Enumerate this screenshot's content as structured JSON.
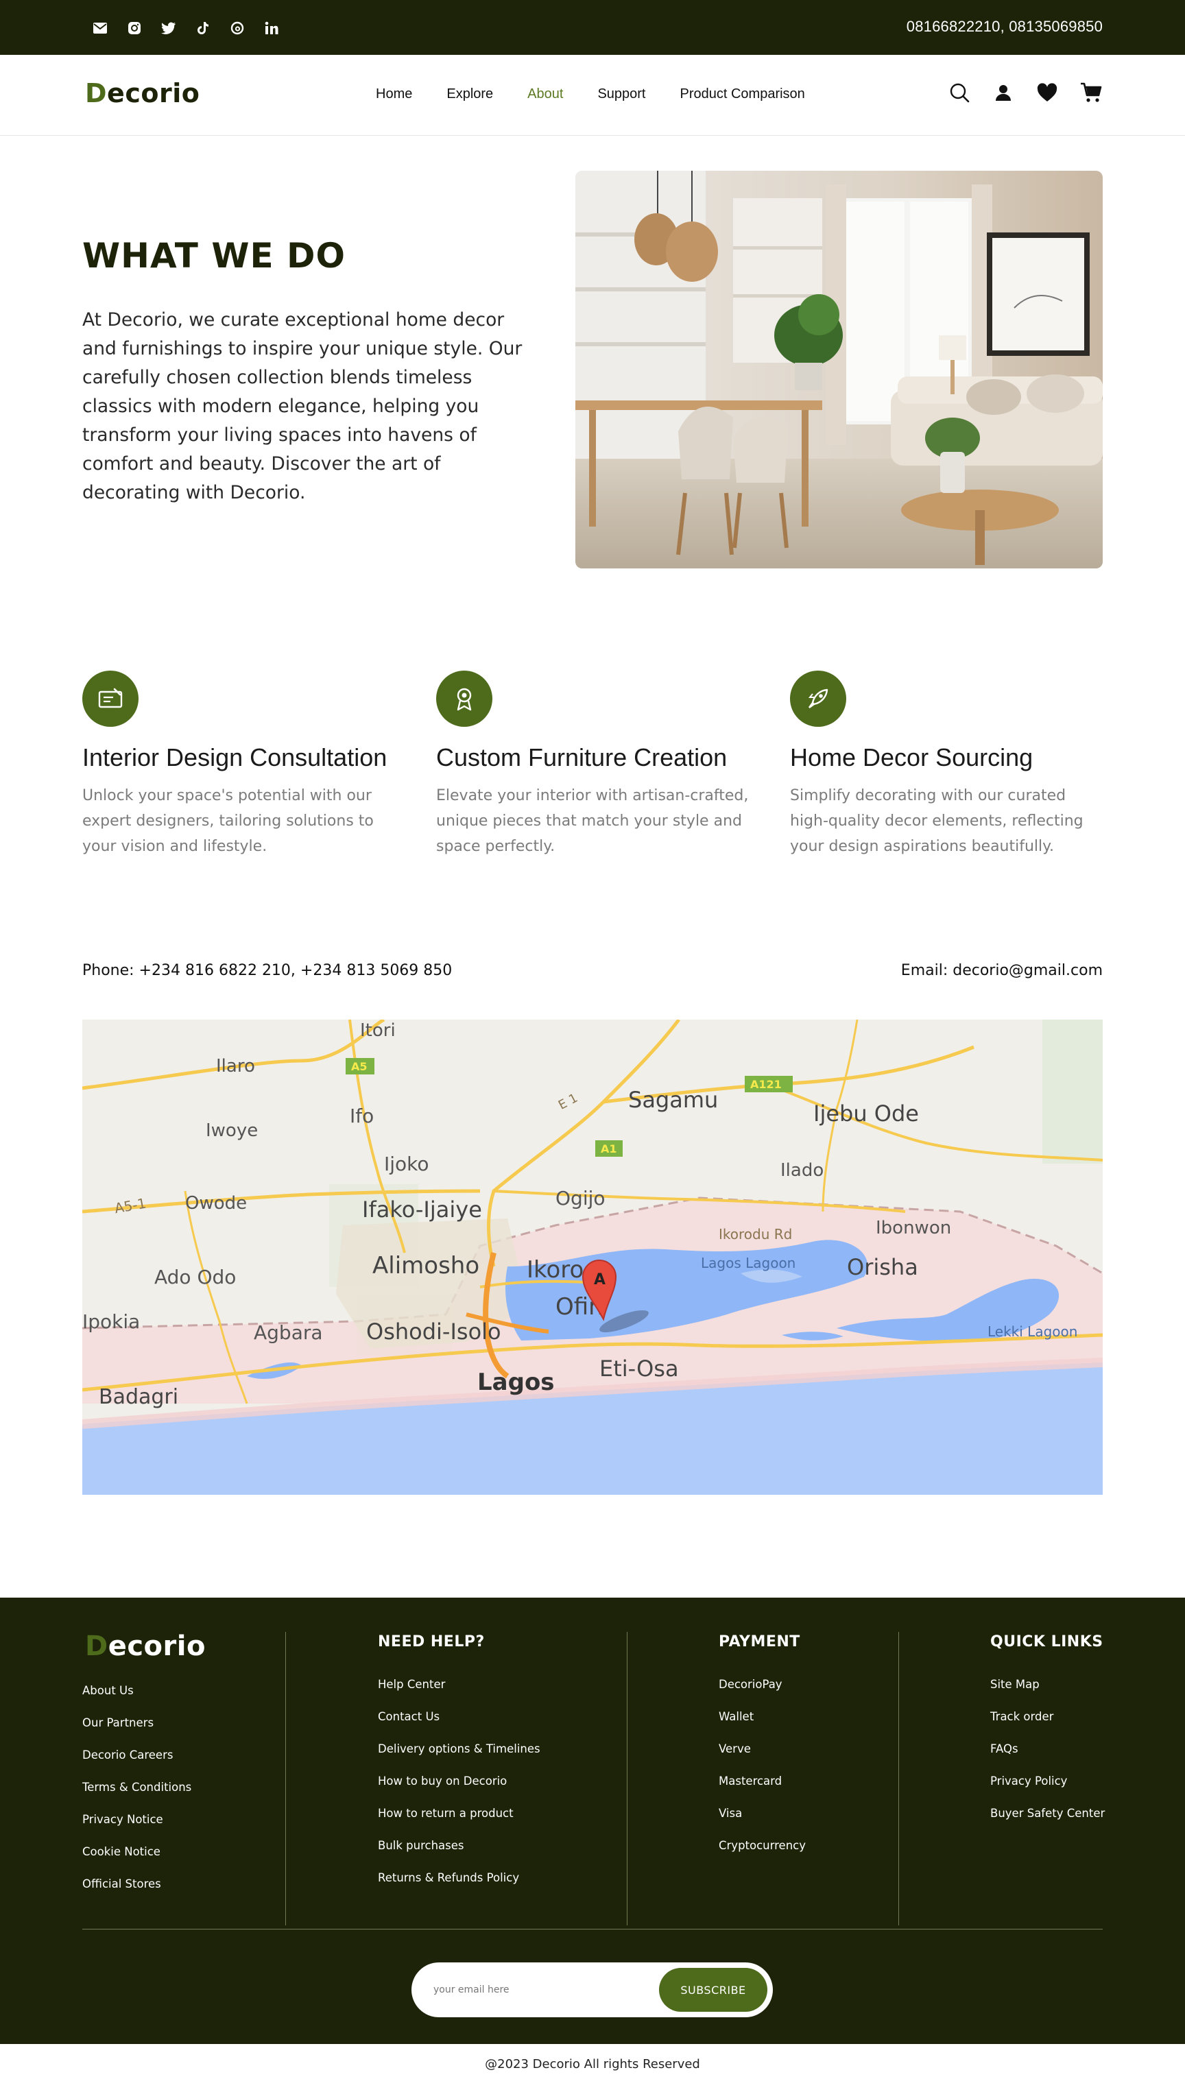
{
  "topbar": {
    "social_icons": [
      "mail-icon",
      "instagram-icon",
      "twitter-icon",
      "tiktok-icon",
      "threads-icon",
      "linkedin-icon"
    ],
    "phones": "08166822210,  08135069850"
  },
  "nav": {
    "logo_d": "D",
    "logo_rest": "ecorio",
    "menu": [
      "Home",
      "Explore",
      "About",
      "Support",
      "Product Comparison"
    ],
    "active": "About",
    "icons": [
      "search-icon",
      "user-icon",
      "heart-icon",
      "cart-icon"
    ]
  },
  "about": {
    "title": "WHAT WE DO",
    "text": "At Decorio, we curate exceptional home decor and furnishings to inspire your unique style. Our carefully chosen collection blends timeless classics with modern elegance, helping you transform your living spaces into havens of comfort and beauty. Discover the art of decorating with Decorio."
  },
  "services": [
    {
      "icon": "certificate-icon",
      "title": "Interior Design Consultation",
      "text": "Unlock your space's potential with our expert designers, tailoring solutions to your vision and lifestyle."
    },
    {
      "icon": "award-icon",
      "title": "Custom Furniture Creation",
      "text": "Elevate your interior with artisan-crafted, unique pieces that match your style and space perfectly."
    },
    {
      "icon": "rocket-icon",
      "title": "Home Decor Sourcing",
      "text": "Simplify decorating with our curated high-quality decor elements, reflecting your design aspirations beautifully."
    }
  ],
  "contact": {
    "phone": "Phone: +234 816 6822 210,  +234 813 5069 850",
    "email": "Email: decorio@gmail.com"
  },
  "map": {
    "marker": "A",
    "labels": [
      "Itori",
      "Ilaro",
      "A5",
      "A121",
      "Sagamu",
      "Ijebu Ode",
      "Iwoye",
      "Ifo",
      "E 1",
      "A1",
      "Ijoko",
      "Ilado",
      "A5-1",
      "Owode",
      "Ifako-Ijaiye",
      "Ogijo",
      "Ikorodu Rd",
      "Ibonwon",
      "Ado Odo",
      "Alimosho",
      "Ikoro",
      "Lagos Lagoon",
      "Orisha",
      "Ipokia",
      "Agbara",
      "Oshodi-Isolo",
      "Ofin",
      "Lekki Lagoon",
      "Eti-Osa",
      "Badagri",
      "Lagos"
    ]
  },
  "footer": {
    "logo_d": "D",
    "logo_rest": "ecorio",
    "about_links": [
      "About Us",
      "Our Partners",
      "Decorio Careers",
      "Terms & Conditions",
      "Privacy Notice",
      "Cookie Notice",
      "Official Stores"
    ],
    "help": {
      "title": "NEED HELP?",
      "links": [
        "Help Center",
        "Contact Us",
        "Delivery options & Timelines",
        "How to buy on Decorio",
        "How to return a product",
        "Bulk purchases",
        "Returns & Refunds Policy"
      ]
    },
    "payment": {
      "title": "PAYMENT",
      "links": [
        "DecorioPay",
        "Wallet",
        "Verve",
        "Mastercard",
        "Visa",
        "Cryptocurrency"
      ]
    },
    "quick": {
      "title": "QUICK LINKS",
      "links": [
        "Site Map",
        "Track order",
        "FAQs",
        "Privacy Policy",
        "Buyer Safety Center"
      ]
    },
    "subscribe_placeholder": "your email here",
    "subscribe_button": "SUBSCRIBE",
    "copyright": "@2023 Decorio All rights Reserved"
  },
  "colors": {
    "dark": "#1c2308",
    "accent": "#4e6b1c",
    "active_link": "#5c7a23"
  }
}
